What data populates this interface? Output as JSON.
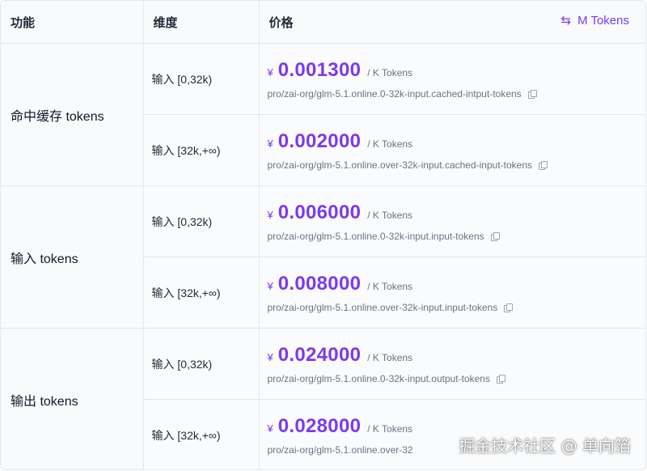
{
  "table": {
    "headers": {
      "feature": "功能",
      "dimension": "维度",
      "price": "价格"
    },
    "unit_toggle": {
      "icon": "swap-arrows-icon",
      "label": "M Tokens"
    },
    "groups": [
      {
        "feature": "命中缓存 tokens",
        "rows": [
          {
            "dimension": "输入 [0,32k)",
            "currency": "¥",
            "amount": "0.001300",
            "per_unit": "/ K Tokens",
            "path": "pro/zai-org/glm-5.1.online.0-32k-input.cached-intput-tokens"
          },
          {
            "dimension": "输入 [32k,+∞)",
            "currency": "¥",
            "amount": "0.002000",
            "per_unit": "/ K Tokens",
            "path": "pro/zai-org/glm-5.1.online.over-32k-input.cached-input-tokens"
          }
        ]
      },
      {
        "feature": "输入 tokens",
        "rows": [
          {
            "dimension": "输入 [0,32k)",
            "currency": "¥",
            "amount": "0.006000",
            "per_unit": "/ K Tokens",
            "path": "pro/zai-org/glm-5.1.online.0-32k-input.input-tokens"
          },
          {
            "dimension": "输入 [32k,+∞)",
            "currency": "¥",
            "amount": "0.008000",
            "per_unit": "/ K Tokens",
            "path": "pro/zai-org/glm-5.1.online.over-32k-input.input-tokens"
          }
        ]
      },
      {
        "feature": "输出 tokens",
        "rows": [
          {
            "dimension": "输入 [0,32k)",
            "currency": "¥",
            "amount": "0.024000",
            "per_unit": "/ K Tokens",
            "path": "pro/zai-org/glm-5.1.online.0-32k-input.output-tokens"
          },
          {
            "dimension": "输入 [32k,+∞)",
            "currency": "¥",
            "amount": "0.028000",
            "per_unit": "/ K Tokens",
            "path": "pro/zai-org/glm-5.1.online.over-32"
          }
        ]
      }
    ]
  },
  "watermark": "掘金技术社区 @ 单向箔",
  "colors": {
    "accent": "#7c3aed",
    "muted_text": "#6b7280",
    "border": "#e5e7eb",
    "header_bg": "#f9fafb"
  }
}
